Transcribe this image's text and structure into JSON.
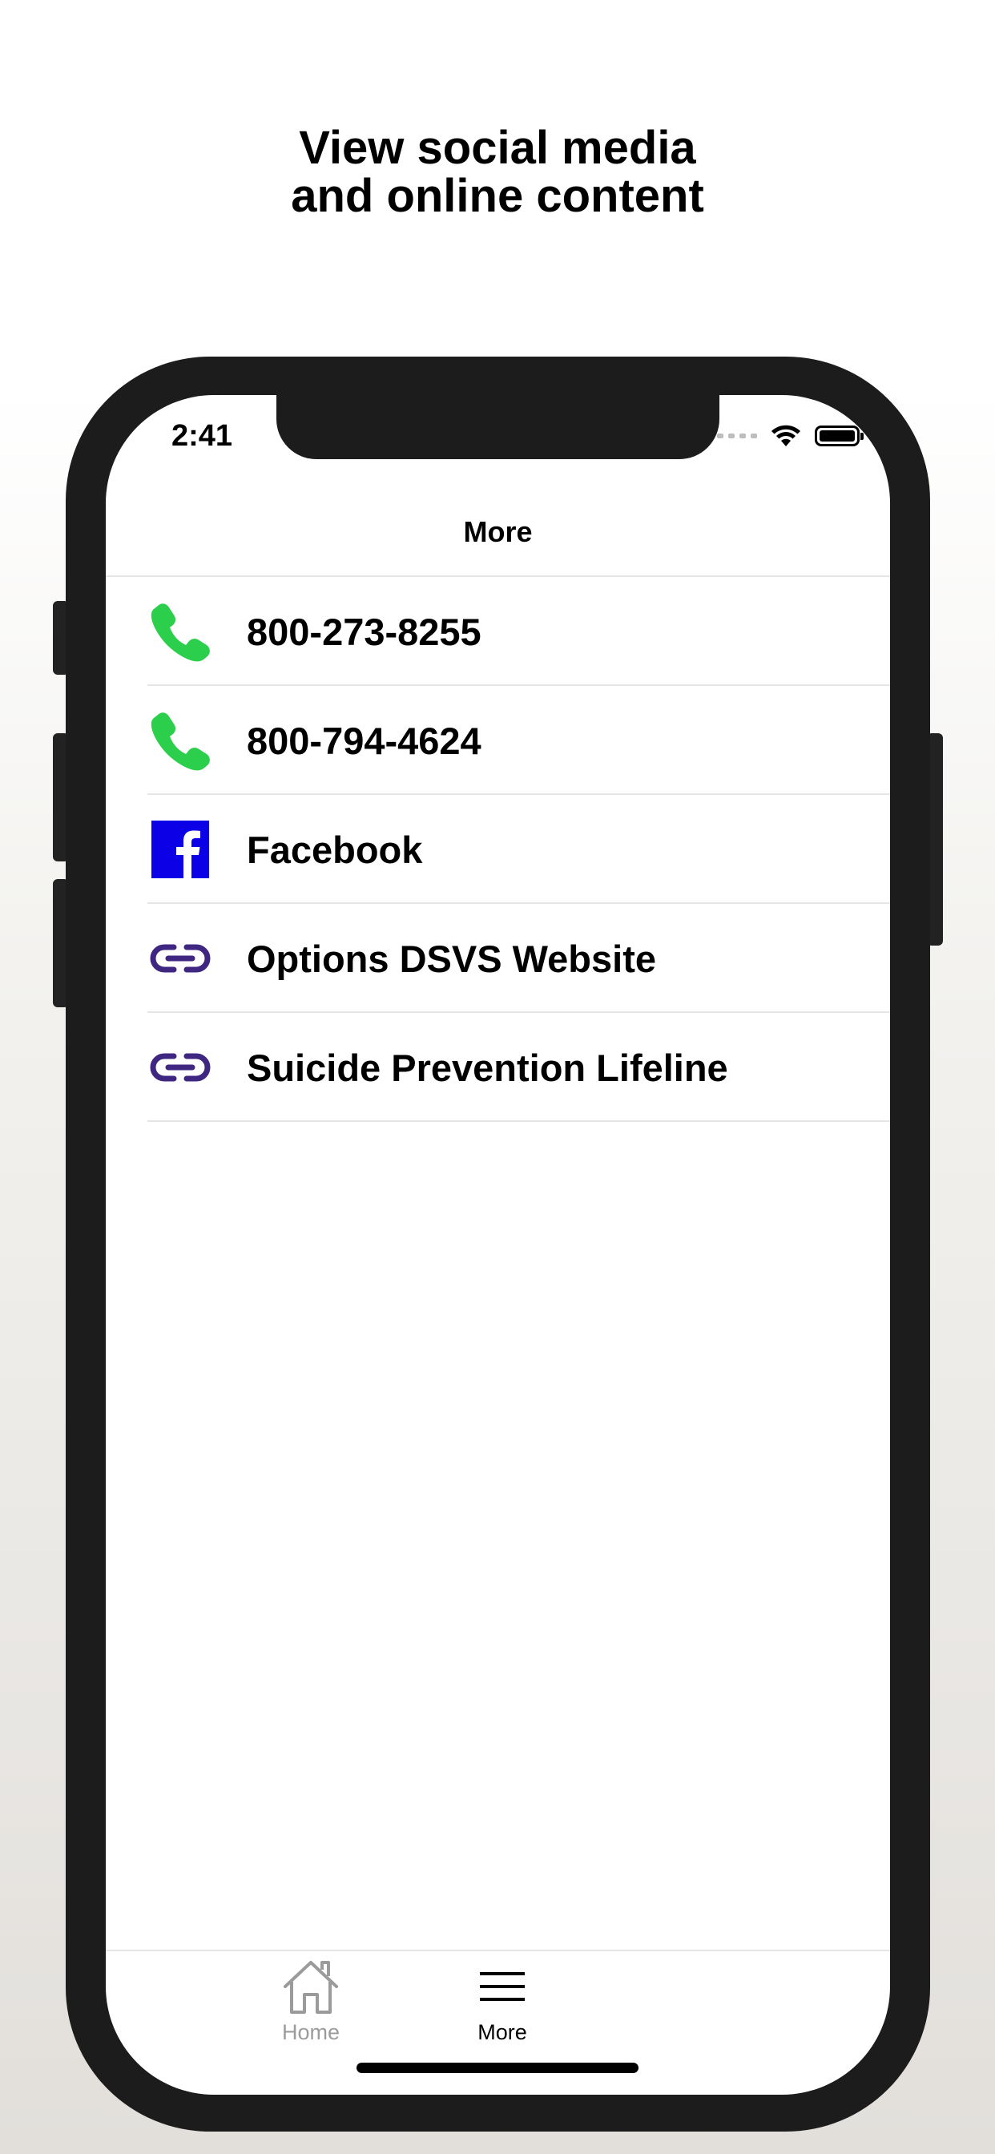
{
  "headline": {
    "line1": "View social media",
    "line2": "and online content"
  },
  "status_bar": {
    "time": "2:41"
  },
  "nav": {
    "title": "More"
  },
  "list_items": [
    {
      "label": "800-273-8255",
      "icon": "phone-icon",
      "color": "#2ccf4b"
    },
    {
      "label": "800-794-4624",
      "icon": "phone-icon",
      "color": "#2ccf4b"
    },
    {
      "label": "Facebook",
      "icon": "facebook-icon",
      "color": "#0c00e6"
    },
    {
      "label": "Options DSVS Website",
      "icon": "link-icon",
      "color": "#3f2680"
    },
    {
      "label": "Suicide Prevention Lifeline",
      "icon": "link-icon",
      "color": "#3f2680"
    }
  ],
  "tabbar": {
    "home_label": "Home",
    "more_label": "More",
    "active_color": "#000000",
    "inactive_color": "#9b9b9b"
  }
}
